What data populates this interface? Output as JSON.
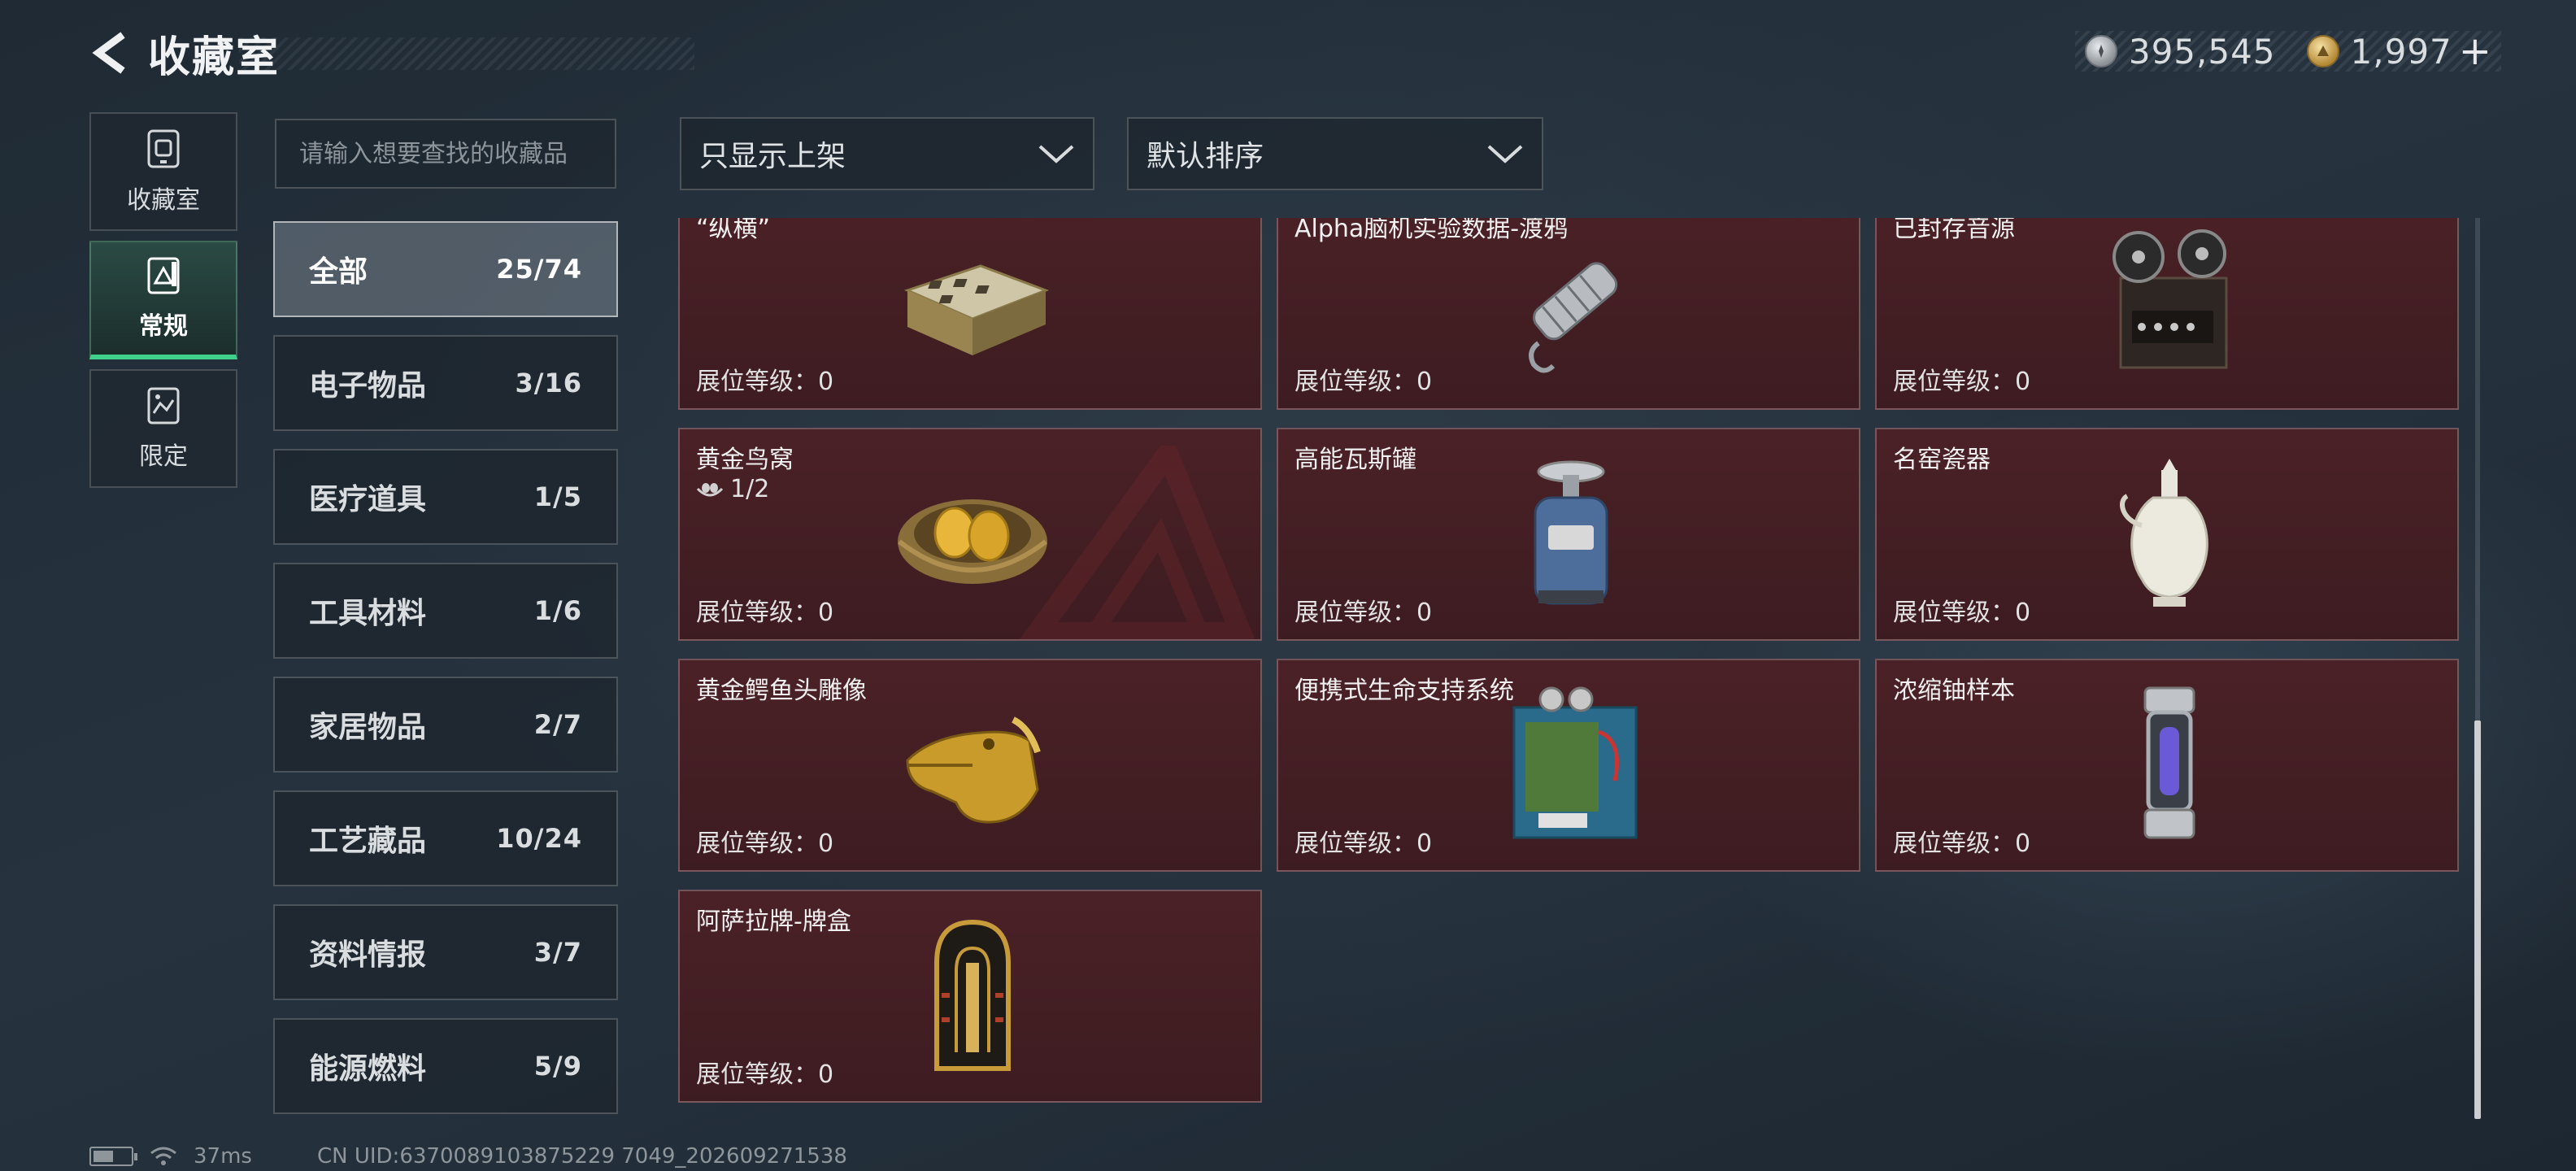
{
  "header": {
    "title": "收藏室"
  },
  "currency": {
    "silver": "395,545",
    "gold": "1,997",
    "plus": "+"
  },
  "side_tabs": [
    {
      "label": "收藏室",
      "icon": "collection-room-icon",
      "active": false
    },
    {
      "label": "常规",
      "icon": "regular-icon",
      "active": true
    },
    {
      "label": "限定",
      "icon": "limited-icon",
      "active": false
    }
  ],
  "search": {
    "placeholder": "请输入想要查找的收藏品",
    "value": ""
  },
  "filters": {
    "display": "只显示上架",
    "sort": "默认排序"
  },
  "categories": [
    {
      "name": "全部",
      "count": "25/74",
      "active": true
    },
    {
      "name": "电子物品",
      "count": "3/16"
    },
    {
      "name": "医疗道具",
      "count": "1/5"
    },
    {
      "name": "工具材料",
      "count": "1/6"
    },
    {
      "name": "家居物品",
      "count": "2/7"
    },
    {
      "name": "工艺藏品",
      "count": "10/24"
    },
    {
      "name": "资料情报",
      "count": "3/7"
    },
    {
      "name": "能源燃料",
      "count": "5/9"
    }
  ],
  "level_label": "展位等级：0",
  "items": [
    {
      "name": "“纵横”",
      "icon": "chess-box-icon"
    },
    {
      "name": "Alpha脑机实验数据-渡鸦",
      "icon": "data-drive-icon"
    },
    {
      "name": "已封存音源",
      "icon": "reel-recorder-icon"
    },
    {
      "name": "黄金鸟窝",
      "icon": "golden-nest-icon",
      "sub": "1/2"
    },
    {
      "name": "高能瓦斯罐",
      "icon": "gas-canister-icon"
    },
    {
      "name": "名窑瓷器",
      "icon": "porcelain-vase-icon"
    },
    {
      "name": "黄金鳄鱼头雕像",
      "icon": "gold-crocodile-icon"
    },
    {
      "name": "便携式生命支持系统",
      "icon": "life-support-icon"
    },
    {
      "name": "浓缩铀样本",
      "icon": "uranium-sample-icon"
    },
    {
      "name": "阿萨拉牌-牌盒",
      "icon": "card-box-icon"
    }
  ],
  "status_bar": {
    "ping": "37ms",
    "uid": "CN UID:6370089103875229 7049_202609271538"
  }
}
